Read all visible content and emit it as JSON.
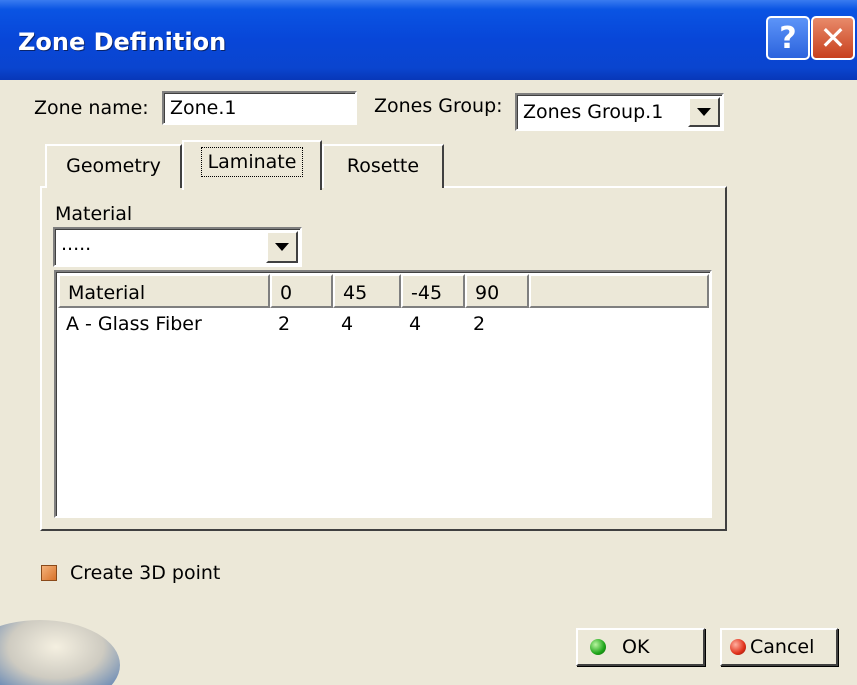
{
  "window": {
    "title": "Zone Definition"
  },
  "titlebar": {
    "help_label": "?",
    "close_label": "✕"
  },
  "zone_name": {
    "label": "Zone name:",
    "value": "Zone.1"
  },
  "zones_group": {
    "label": "Zones Group:",
    "value": "Zones Group.1"
  },
  "tabs": [
    {
      "label": "Geometry",
      "active": false
    },
    {
      "label": "Laminate",
      "active": true
    },
    {
      "label": "Rosette",
      "active": false
    }
  ],
  "laminate": {
    "material_label": "Material",
    "material_value": ".....",
    "table": {
      "columns": [
        "Material",
        "0",
        "45",
        "-45",
        "90"
      ],
      "rows": [
        [
          "A - Glass Fiber",
          "2",
          "4",
          "4",
          "2"
        ]
      ]
    }
  },
  "create_3d_point": {
    "label": "Create 3D point",
    "checked": true
  },
  "buttons": {
    "ok": "OK",
    "cancel": "Cancel"
  },
  "colors": {
    "titlebar": "#0a54e3",
    "dialog_bg": "#ece8d8",
    "checkbox": "#e08a3c"
  }
}
